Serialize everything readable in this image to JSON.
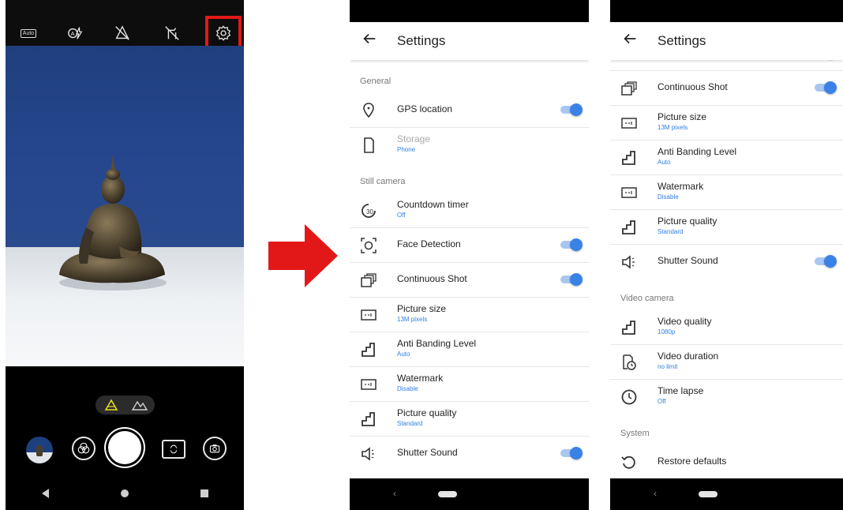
{
  "camera": {
    "top_icons": [
      "auto-icon",
      "flash-auto-icon",
      "hdr-off-icon",
      "timer-off-icon",
      "gear-icon"
    ],
    "auto_label": "Auto",
    "mode_icons": [
      "triangle-mode-icon",
      "landscape-mode-icon"
    ],
    "accent_color": "#e8e019",
    "highlight_color": "#e21818"
  },
  "arrow_color": "#e21818",
  "settings_left": {
    "title": "Settings",
    "general_header": "General",
    "gps": {
      "label": "GPS location",
      "on": true
    },
    "storage": {
      "label": "Storage",
      "value": "Phone"
    },
    "still_header": "Still camera",
    "countdown": {
      "label": "Countdown timer",
      "value": "Off"
    },
    "face": {
      "label": "Face Detection",
      "on": true
    },
    "continuous": {
      "label": "Continuous Shot",
      "on": true
    },
    "picsize": {
      "label": "Picture size",
      "value": "13M pixels"
    },
    "antiband": {
      "label": "Anti Banding Level",
      "value": "Auto"
    },
    "watermark": {
      "label": "Watermark",
      "value": "Disable"
    },
    "picquality": {
      "label": "Picture quality",
      "value": "Standard"
    },
    "shutter": {
      "label": "Shutter Sound",
      "on": true
    }
  },
  "settings_right": {
    "title": "Settings",
    "continuous": {
      "label": "Continuous Shot",
      "on": true
    },
    "picsize": {
      "label": "Picture size",
      "value": "13M pixels"
    },
    "antiband": {
      "label": "Anti Banding Level",
      "value": "Auto"
    },
    "watermark": {
      "label": "Watermark",
      "value": "Disable"
    },
    "picquality": {
      "label": "Picture quality",
      "value": "Standard"
    },
    "shutter": {
      "label": "Shutter Sound",
      "on": true
    },
    "video_header": "Video camera",
    "videoquality": {
      "label": "Video quality",
      "value": "1080p"
    },
    "videoduration": {
      "label": "Video duration",
      "value": "no limit"
    },
    "timelapse": {
      "label": "Time lapse",
      "value": "Off"
    },
    "system_header": "System",
    "restore": {
      "label": "Restore defaults"
    }
  },
  "toggle_color": "#3a82e6",
  "subtitle_color": "#2f7fe0"
}
